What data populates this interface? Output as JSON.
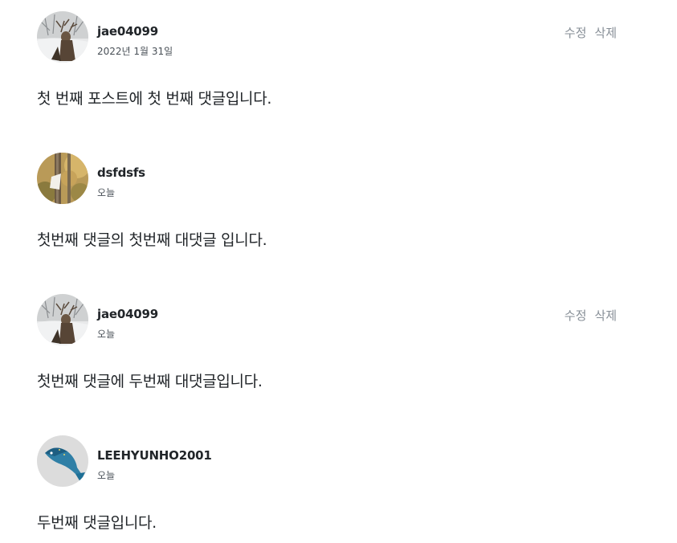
{
  "comments": [
    {
      "author": "jae04099",
      "date": "2022년 1월 31일",
      "body": "첫 번째 포스트에 첫 번째 댓글입니다.",
      "avatar_icon": "deer-avatar-icon",
      "edit_label": "수정",
      "delete_label": "삭제"
    },
    {
      "author": "dsfdsfs",
      "date": "오늘",
      "body": "첫번째 댓글의 첫번째 대댓글 입니다.",
      "avatar_icon": "forest-avatar-icon"
    },
    {
      "author": "jae04099",
      "date": "오늘",
      "body": "첫번째 댓글에 두번째 대댓글입니다.",
      "avatar_icon": "deer-avatar-icon",
      "edit_label": "수정",
      "delete_label": "삭제"
    },
    {
      "author": "LEEHYUNHO2001",
      "date": "오늘",
      "body": "두번째 댓글입니다.",
      "avatar_icon": "fish-avatar-icon"
    }
  ]
}
